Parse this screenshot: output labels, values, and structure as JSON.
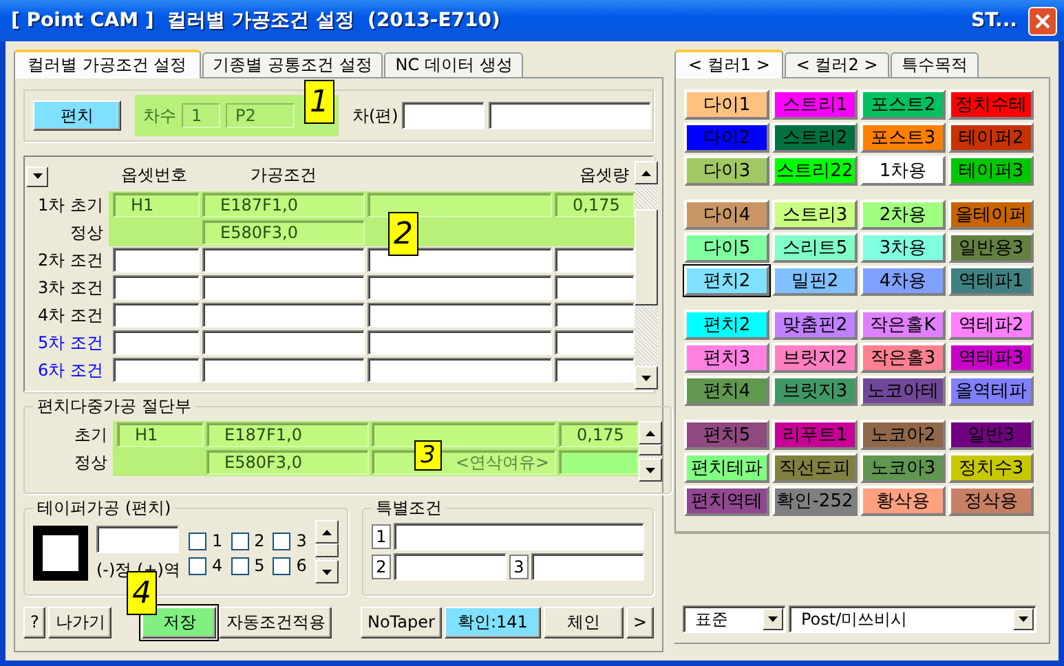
{
  "window": {
    "title": "[ Point CAM ]  컬러별 가공조건 설정  (2013-E710)",
    "title_right": "ST..."
  },
  "left_tabs": [
    {
      "label": "컬러별 가공조건 설정",
      "selected": true
    },
    {
      "label": "기종별 공통조건 설정",
      "selected": false
    },
    {
      "label": "NC 데이터 생성",
      "selected": false
    }
  ],
  "top_group": {
    "punch_button": "편치",
    "order_label": "차수",
    "order_value": "1",
    "order_code": "P2",
    "callout": "1",
    "side_label": "차(편)"
  },
  "grid": {
    "callout": "2",
    "columns": [
      "옵셋번호",
      "가공조건",
      "",
      "옵셋량"
    ],
    "rows": [
      {
        "label": "1차 초기",
        "kind": "full",
        "color": "#000000",
        "highlighted": true,
        "cells": [
          "H1",
          "E187F1,0",
          "",
          "0,175"
        ]
      },
      {
        "label": "정상",
        "kind": "condition_only",
        "color": "#000000",
        "highlighted": true,
        "cells": [
          "",
          "E580F3,0",
          "",
          ""
        ]
      },
      {
        "label": "2차 조건",
        "kind": "full",
        "color": "#000000",
        "highlighted": false,
        "cells": [
          "",
          "",
          "",
          ""
        ]
      },
      {
        "label": "3차 조건",
        "kind": "full",
        "color": "#000000",
        "highlighted": false,
        "cells": [
          "",
          "",
          "",
          ""
        ]
      },
      {
        "label": "4차 조건",
        "kind": "full",
        "color": "#000000",
        "highlighted": false,
        "cells": [
          "",
          "",
          "",
          ""
        ]
      },
      {
        "label": "5차 조건",
        "kind": "full",
        "color": "#0000ff",
        "highlighted": false,
        "cells": [
          "",
          "",
          "",
          ""
        ]
      },
      {
        "label": "6차 조건",
        "kind": "full",
        "color": "#0000ff",
        "highlighted": false,
        "cells": [
          "",
          "",
          "",
          ""
        ]
      }
    ]
  },
  "cut_group": {
    "title": "편치다중가공 절단부",
    "callout": "3",
    "rows": [
      {
        "label": "초기",
        "kind": "full",
        "color": "#000000",
        "highlighted": true,
        "cells": [
          "H1",
          "E187F1,0",
          "",
          "0,175"
        ]
      },
      {
        "label": "정상",
        "kind": "no_offset_no",
        "color": "#000000",
        "highlighted": true,
        "cells": [
          "",
          "E580F3,0",
          "",
          ""
        ],
        "placeholder": "<연삭여유>"
      }
    ]
  },
  "taper": {
    "title": "테이퍼가공 (편치)",
    "hint": "(-)정 (+)역",
    "checkboxes": [
      {
        "label": "1",
        "checked": false
      },
      {
        "label": "2",
        "checked": false
      },
      {
        "label": "3",
        "checked": false
      },
      {
        "label": "4",
        "checked": false
      },
      {
        "label": "5",
        "checked": false
      },
      {
        "label": "6",
        "checked": false
      }
    ]
  },
  "special": {
    "title": "특별조건",
    "fields": [
      {
        "label": "1"
      },
      {
        "label": "2"
      },
      {
        "label": "3"
      }
    ]
  },
  "left_buttons": [
    {
      "label": "?",
      "kind": "normal"
    },
    {
      "label": "나가기",
      "kind": "normal"
    }
  ],
  "save_callout": "4",
  "mid_buttons": [
    {
      "label": "저장",
      "kind": "save"
    },
    {
      "label": "자동조건적용",
      "kind": "normal"
    }
  ],
  "right_buttons": [
    {
      "label": "NoTaper",
      "kind": "normal"
    },
    {
      "label": "확인:141",
      "kind": "info"
    },
    {
      "label": "체인",
      "kind": "normal"
    },
    {
      "label": ">",
      "kind": "normal"
    }
  ],
  "right_tabs": [
    {
      "label": "< 컬러1 >",
      "selected": true
    },
    {
      "label": "< 컬러2 >",
      "selected": false
    },
    {
      "label": "특수목적",
      "selected": false
    }
  ],
  "color_groups": [
    [
      {
        "label": "다이1",
        "color": "#ffc080",
        "selected": false
      },
      {
        "label": "스트리1",
        "color": "#ff00ff",
        "selected": false
      },
      {
        "label": "포스트2",
        "color": "#00c060",
        "selected": false
      },
      {
        "label": "정치수테",
        "color": "#ff0000",
        "selected": false
      },
      {
        "label": "다이2",
        "color": "#0000ff",
        "selected": false
      },
      {
        "label": "스트리2",
        "color": "#007040",
        "selected": false
      },
      {
        "label": "포스트3",
        "color": "#ff8000",
        "selected": false
      },
      {
        "label": "테이퍼2",
        "color": "#c83200",
        "selected": false
      },
      {
        "label": "다이3",
        "color": "#a0c864",
        "selected": false
      },
      {
        "label": "스트리22",
        "color": "#00ff00",
        "selected": false
      },
      {
        "label": "1차용",
        "color": "#ffffff",
        "selected": false
      },
      {
        "label": "테이퍼3",
        "color": "#00c800",
        "selected": false
      }
    ],
    [
      {
        "label": "다이4",
        "color": "#c89664",
        "selected": false
      },
      {
        "label": "스트리3",
        "color": "#c8ff80",
        "selected": false
      },
      {
        "label": "2차용",
        "color": "#a0ff80",
        "selected": false
      },
      {
        "label": "올테이퍼",
        "color": "#c86400",
        "selected": false
      },
      {
        "label": "다이5",
        "color": "#80ffa0",
        "selected": false
      },
      {
        "label": "스리트5",
        "color": "#80ffc8",
        "selected": false
      },
      {
        "label": "3차용",
        "color": "#80ffe0",
        "selected": false
      },
      {
        "label": "일반용3",
        "color": "#648040",
        "selected": false
      },
      {
        "label": "편치2",
        "color": "#80e0ff",
        "selected": true
      },
      {
        "label": "밀핀2",
        "color": "#80c0ff",
        "selected": false
      },
      {
        "label": "4차용",
        "color": "#80a0ff",
        "selected": false
      },
      {
        "label": "역테파1",
        "color": "#408080",
        "selected": false
      }
    ],
    [
      {
        "label": "편치2",
        "color": "#00ffff",
        "selected": false
      },
      {
        "label": "맞춤핀2",
        "color": "#c080ff",
        "selected": false
      },
      {
        "label": "작은홀K",
        "color": "#e080ff",
        "selected": false
      },
      {
        "label": "역테파2",
        "color": "#ff80ff",
        "selected": false
      },
      {
        "label": "편치3",
        "color": "#ff80e0",
        "selected": false
      },
      {
        "label": "브릿지2",
        "color": "#ff80c0",
        "selected": false
      },
      {
        "label": "작은홀3",
        "color": "#ff8090",
        "selected": false
      },
      {
        "label": "역테파3",
        "color": "#c800c8",
        "selected": false
      },
      {
        "label": "편치4",
        "color": "#609850",
        "selected": false
      },
      {
        "label": "브릿지3",
        "color": "#409864",
        "selected": false
      },
      {
        "label": "노코아테",
        "color": "#704898",
        "selected": false
      },
      {
        "label": "올역테파",
        "color": "#8080ff",
        "selected": false
      }
    ],
    [
      {
        "label": "편치5",
        "color": "#904880",
        "selected": false
      },
      {
        "label": "리푸트1",
        "color": "#c80096",
        "selected": false
      },
      {
        "label": "노코아2",
        "color": "#906848",
        "selected": false
      },
      {
        "label": "일반3",
        "color": "#700080",
        "selected": false
      },
      {
        "label": "편치테파",
        "color": "#80ff80",
        "selected": false
      },
      {
        "label": "직선도피",
        "color": "#808040",
        "selected": false
      },
      {
        "label": "노코아3",
        "color": "#609650",
        "selected": false
      },
      {
        "label": "정치수3",
        "color": "#c8c800",
        "selected": false
      },
      {
        "label": "편치역테",
        "color": "#904890",
        "selected": false
      },
      {
        "label": "확인-252",
        "color": "#808080",
        "selected": false
      },
      {
        "label": "황삭용",
        "color": "#ffa080",
        "selected": false
      },
      {
        "label": "정삭용",
        "color": "#c88064",
        "selected": false
      }
    ]
  ],
  "dropdowns": [
    {
      "value": "표준"
    },
    {
      "value": "Post/미쓰비시"
    }
  ]
}
